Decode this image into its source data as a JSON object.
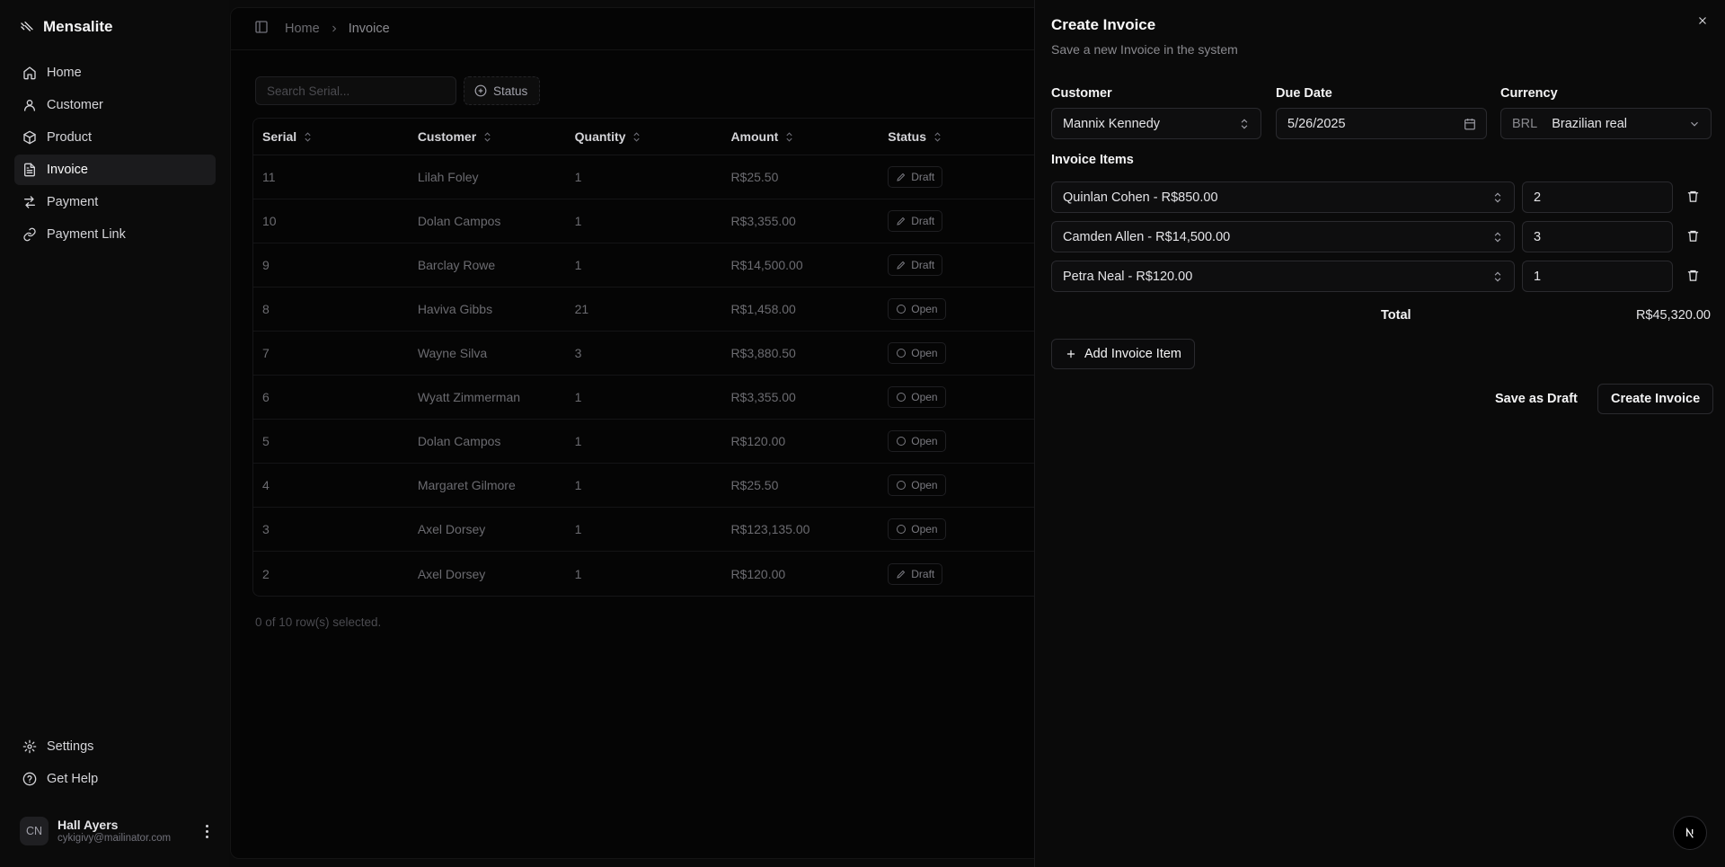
{
  "app": {
    "brand": "Mensalite"
  },
  "sidebar": {
    "items": [
      {
        "label": "Home",
        "icon": "house-icon"
      },
      {
        "label": "Customer",
        "icon": "user-icon"
      },
      {
        "label": "Product",
        "icon": "package-icon"
      },
      {
        "label": "Invoice",
        "icon": "file-text-icon",
        "active": true
      },
      {
        "label": "Payment",
        "icon": "arrows-icon"
      },
      {
        "label": "Payment Link",
        "icon": "link-icon"
      }
    ],
    "bottom": [
      {
        "label": "Settings",
        "icon": "gear-icon"
      },
      {
        "label": "Get Help",
        "icon": "help-circle-icon"
      }
    ],
    "user": {
      "initials": "CN",
      "name": "Hall Ayers",
      "email": "cykigivy@mailinator.com"
    }
  },
  "breadcrumb": {
    "home": "Home",
    "current": "Invoice"
  },
  "toolbar": {
    "search_placeholder": "Search Serial...",
    "status_filter": "Status"
  },
  "table": {
    "headers": [
      "Serial",
      "Customer",
      "Quantity",
      "Amount",
      "Status"
    ],
    "rows": [
      {
        "serial": "11",
        "customer": "Lilah Foley",
        "quantity": "1",
        "amount": "R$25.50",
        "status": "Draft"
      },
      {
        "serial": "10",
        "customer": "Dolan Campos",
        "quantity": "1",
        "amount": "R$3,355.00",
        "status": "Draft"
      },
      {
        "serial": "9",
        "customer": "Barclay Rowe",
        "quantity": "1",
        "amount": "R$14,500.00",
        "status": "Draft"
      },
      {
        "serial": "8",
        "customer": "Haviva Gibbs",
        "quantity": "21",
        "amount": "R$1,458.00",
        "status": "Open"
      },
      {
        "serial": "7",
        "customer": "Wayne Silva",
        "quantity": "3",
        "amount": "R$3,880.50",
        "status": "Open"
      },
      {
        "serial": "6",
        "customer": "Wyatt Zimmerman",
        "quantity": "1",
        "amount": "R$3,355.00",
        "status": "Open"
      },
      {
        "serial": "5",
        "customer": "Dolan Campos",
        "quantity": "1",
        "amount": "R$120.00",
        "status": "Open"
      },
      {
        "serial": "4",
        "customer": "Margaret Gilmore",
        "quantity": "1",
        "amount": "R$25.50",
        "status": "Open"
      },
      {
        "serial": "3",
        "customer": "Axel Dorsey",
        "quantity": "1",
        "amount": "R$123,135.00",
        "status": "Open"
      },
      {
        "serial": "2",
        "customer": "Axel Dorsey",
        "quantity": "1",
        "amount": "R$120.00",
        "status": "Draft"
      }
    ],
    "selection_note": "0 of 10 row(s) selected."
  },
  "panel": {
    "title": "Create Invoice",
    "subtitle": "Save a new Invoice in the system",
    "customer_label": "Customer",
    "customer_value": "Mannix Kennedy",
    "due_date_label": "Due Date",
    "due_date_value": "5/26/2025",
    "currency_label": "Currency",
    "currency_code": "BRL",
    "currency_name": "Brazilian real",
    "items_label": "Invoice Items",
    "items": [
      {
        "product": "Quinlan Cohen - R$850.00",
        "qty": "2"
      },
      {
        "product": "Camden Allen - R$14,500.00",
        "qty": "3"
      },
      {
        "product": "Petra Neal - R$120.00",
        "qty": "1"
      }
    ],
    "total_label": "Total",
    "total_value": "R$45,320.00",
    "add_item": "Add Invoice Item",
    "save_draft": "Save as Draft",
    "create": "Create Invoice"
  }
}
